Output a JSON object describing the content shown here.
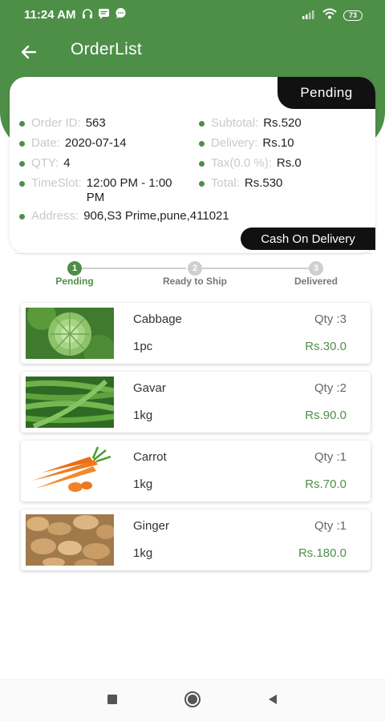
{
  "status_bar": {
    "time": "11:24 AM",
    "battery": "73",
    "icons_left": [
      "headset-icon",
      "message-icon",
      "chat-icon"
    ],
    "icons_right": [
      "signal-icon",
      "wifi-icon",
      "battery-icon"
    ]
  },
  "app_bar": {
    "title": "OrderList",
    "back_icon": "arrow-left-icon"
  },
  "colors": {
    "primary": "#4e8f48",
    "badge_bg": "#111111",
    "label_gray": "#c9c9c9"
  },
  "order": {
    "status_badge": "Pending",
    "payment_badge": "Cash On Delivery",
    "fields_left": [
      {
        "label": "Order ID:",
        "value": "563"
      },
      {
        "label": "Date:",
        "value": "2020-07-14"
      },
      {
        "label": "QTY:",
        "value": "4"
      },
      {
        "label": "TimeSlot:",
        "value": "12:00 PM - 1:00 PM"
      }
    ],
    "fields_right": [
      {
        "label": "Subtotal:",
        "value": "Rs.520"
      },
      {
        "label": "Delivery:",
        "value": "Rs.10"
      },
      {
        "label": "Tax(0.0 %):",
        "value": "Rs.0"
      },
      {
        "label": "Total:",
        "value": "Rs.530"
      }
    ],
    "address": {
      "label": "Address:",
      "value": "906,S3 Prime,pune,411021"
    }
  },
  "stepper": {
    "steps": [
      {
        "number": "1",
        "label": "Pending",
        "active": true
      },
      {
        "number": "2",
        "label": "Ready to Ship",
        "active": false
      },
      {
        "number": "3",
        "label": "Delivered",
        "active": false
      }
    ]
  },
  "products": [
    {
      "name": "Cabbage",
      "unit": "1pc",
      "qty": "Qty :3",
      "price": "Rs.30.0",
      "image": "cabbage"
    },
    {
      "name": "Gavar",
      "unit": "1kg",
      "qty": "Qty :2",
      "price": "Rs.90.0",
      "image": "gavar-beans"
    },
    {
      "name": "Carrot",
      "unit": "1kg",
      "qty": "Qty :1",
      "price": "Rs.70.0",
      "image": "carrot"
    },
    {
      "name": "Ginger",
      "unit": "1kg",
      "qty": "Qty :1",
      "price": "Rs.180.0",
      "image": "ginger"
    }
  ],
  "nav_bar": {
    "buttons": [
      "recents-square-icon",
      "home-circle-icon",
      "back-triangle-icon"
    ]
  }
}
